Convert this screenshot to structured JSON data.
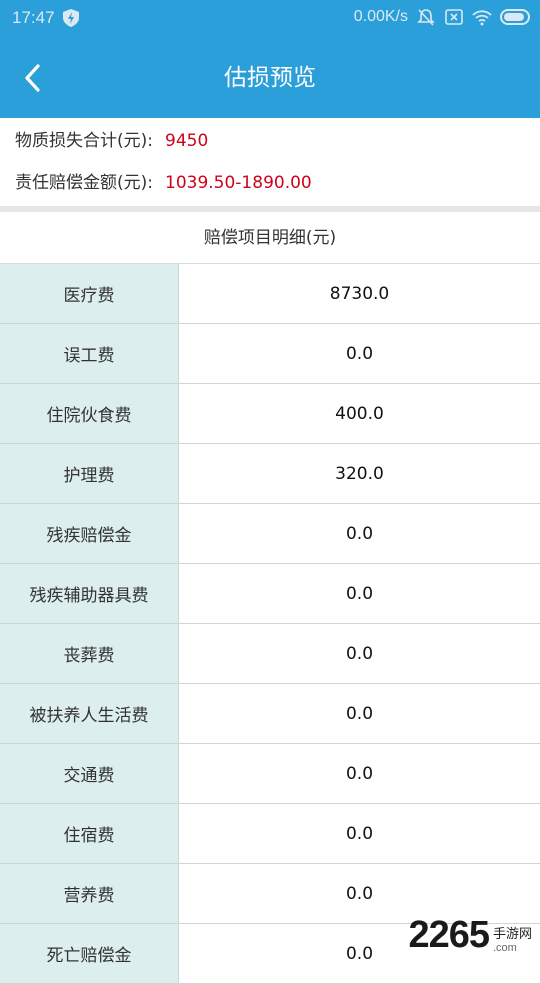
{
  "status_bar": {
    "time": "17:47",
    "net_speed": "0.00K/s"
  },
  "header": {
    "title": "估损预览"
  },
  "summary": {
    "property_loss_label": "物质损失合计(元):",
    "property_loss_value": "9450",
    "liability_label": "责任赔偿金额(元):",
    "liability_value": "1039.50-1890.00"
  },
  "detail": {
    "title": "赔偿项目明细(元)",
    "rows": [
      {
        "name": "医疗费",
        "value": "8730.0"
      },
      {
        "name": "误工费",
        "value": "0.0"
      },
      {
        "name": "住院伙食费",
        "value": "400.0"
      },
      {
        "name": "护理费",
        "value": "320.0"
      },
      {
        "name": "残疾赔偿金",
        "value": "0.0"
      },
      {
        "name": "残疾辅助器具费",
        "value": "0.0"
      },
      {
        "name": "丧葬费",
        "value": "0.0"
      },
      {
        "name": "被扶养人生活费",
        "value": "0.0"
      },
      {
        "name": "交通费",
        "value": "0.0"
      },
      {
        "name": "住宿费",
        "value": "0.0"
      },
      {
        "name": "营养费",
        "value": "0.0"
      },
      {
        "name": "死亡赔偿金",
        "value": "0.0"
      }
    ]
  },
  "watermark": {
    "number": "2265",
    "cn": "手游网",
    "en": ".com"
  },
  "colors": {
    "primary": "#2b9fd9",
    "amount_red": "#d0021b",
    "name_cell_bg": "#ddeeee"
  },
  "icons": [
    "back-arrow-icon",
    "shield-icon",
    "mute-icon",
    "close-box-icon",
    "wifi-icon",
    "battery-icon"
  ]
}
